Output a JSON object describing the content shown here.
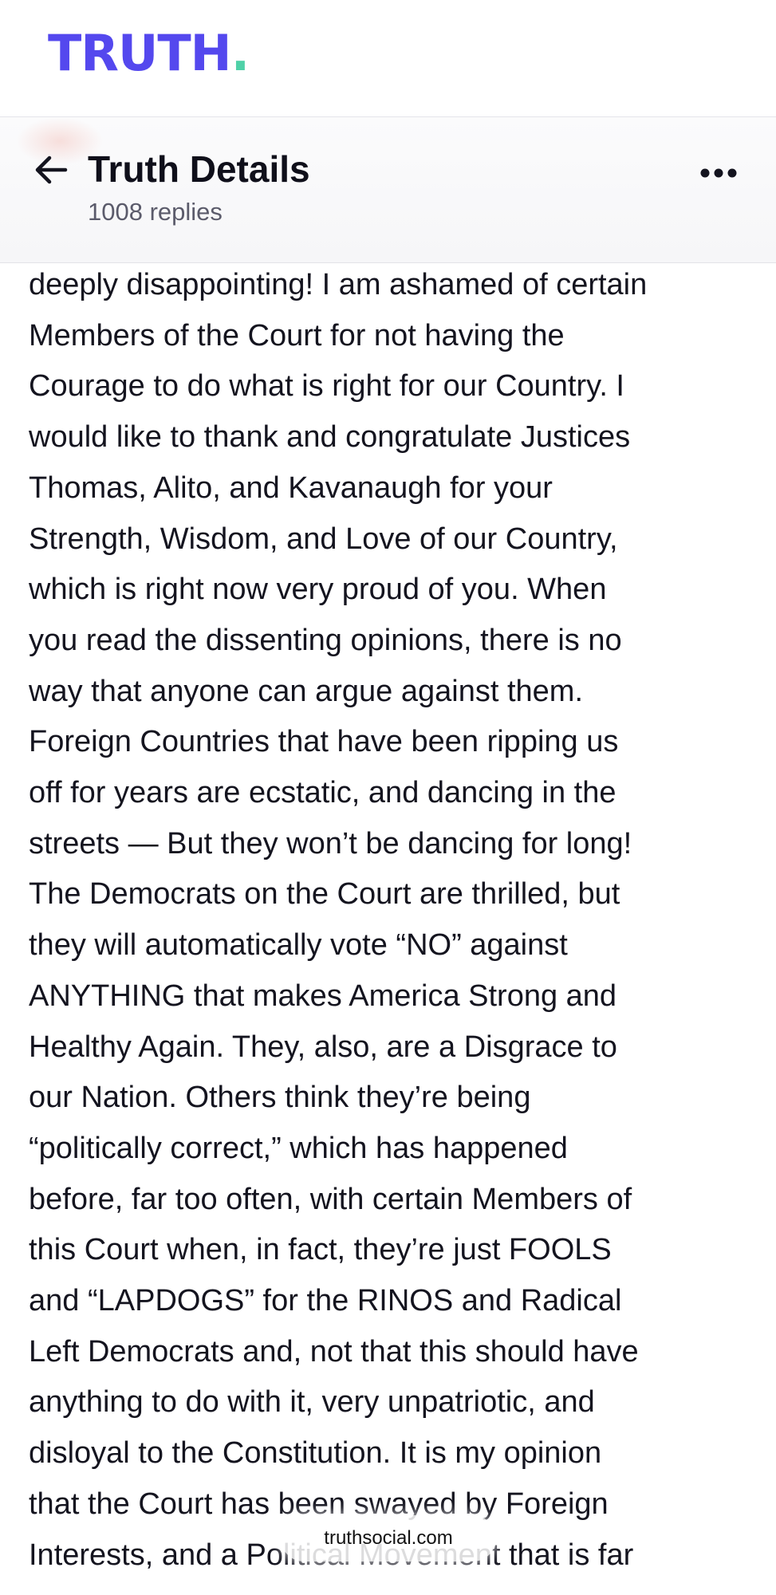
{
  "brand": {
    "logo_text": "TRUTH",
    "logo_dot": ".",
    "colors": {
      "logo": "#5448ee",
      "dot": "#4fd1a8"
    }
  },
  "header": {
    "title": "Truth Details",
    "replies": "1008 replies",
    "back_icon": "arrow-left-icon",
    "more_icon": "more-horizontal-icon"
  },
  "post": {
    "lines": [
      "deeply disappointing! I am ashamed of certain",
      "Members of the Court for not having the",
      "Courage to do what is right for our Country. I",
      "would like to thank and congratulate Justices",
      "Thomas, Alito, and Kavanaugh for your",
      "Strength, Wisdom, and Love of our Country,",
      "which is right now very proud of you. When",
      "you read the dissenting opinions, there is no",
      "way that anyone can argue against them.",
      "Foreign Countries that have been ripping us",
      "off for years are ecstatic, and dancing in the",
      "streets — But they won’t be dancing for long!",
      "The Democrats on the Court are thrilled, but",
      "they will automatically vote “NO” against",
      "ANYTHING that makes America Strong and",
      "Healthy Again. They, also, are a Disgrace to",
      "our Nation. Others think they’re being",
      "“politically correct,” which has happened",
      "before, far too often, with certain Members of",
      "this Court when, in fact, they’re just FOOLS",
      "and “LAPDOGS” for the RINOS and Radical",
      "Left Democrats and, not that this should have",
      "anything to do with it, very unpatriotic, and",
      "disloyal to the Constitution. It is my opinion",
      "that the Court has been swayed by Foreign",
      "Interests, and a Political Movement that is far"
    ]
  },
  "browser": {
    "url": "truthsocial.com"
  }
}
